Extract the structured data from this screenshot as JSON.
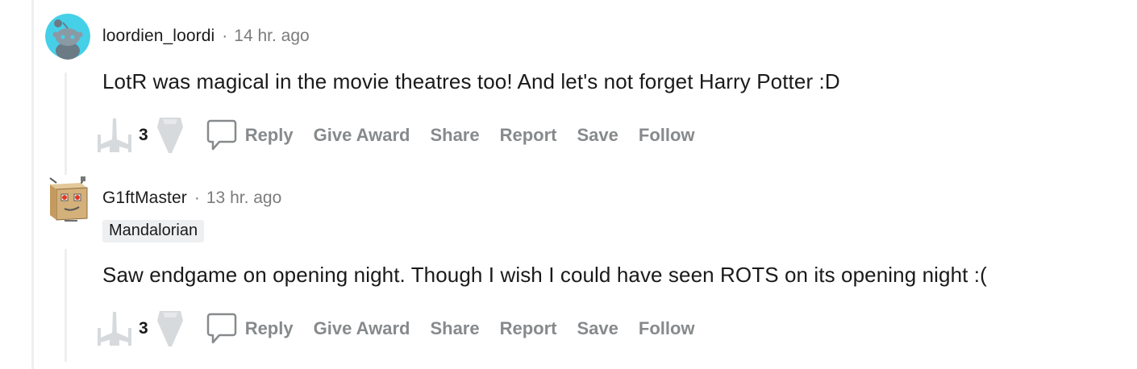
{
  "comments": [
    {
      "username": "loordien_loordi",
      "separator": "·",
      "time": "14 hr. ago",
      "flair": "",
      "body": "LotR was magical in the movie theatres too! And let's not forget Harry Potter :D",
      "score": "3",
      "avatar_icon": "snoo-avatar-icon",
      "avatar_color": "#46d0e8"
    },
    {
      "username": "G1ftMaster",
      "separator": "·",
      "time": "13 hr. ago",
      "flair": "Mandalorian",
      "body": "Saw endgame on opening night. Though I wish I could have seen ROTS on its opening night :(",
      "score": "3",
      "avatar_icon": "box-robot-avatar-icon"
    }
  ],
  "actions": {
    "reply": "Reply",
    "give_award": "Give Award",
    "share": "Share",
    "report": "Report",
    "save": "Save",
    "follow": "Follow"
  },
  "colors": {
    "muted_text": "#878a8c",
    "thread_line": "#edeff1",
    "vote_icon": "#d7dadc"
  }
}
